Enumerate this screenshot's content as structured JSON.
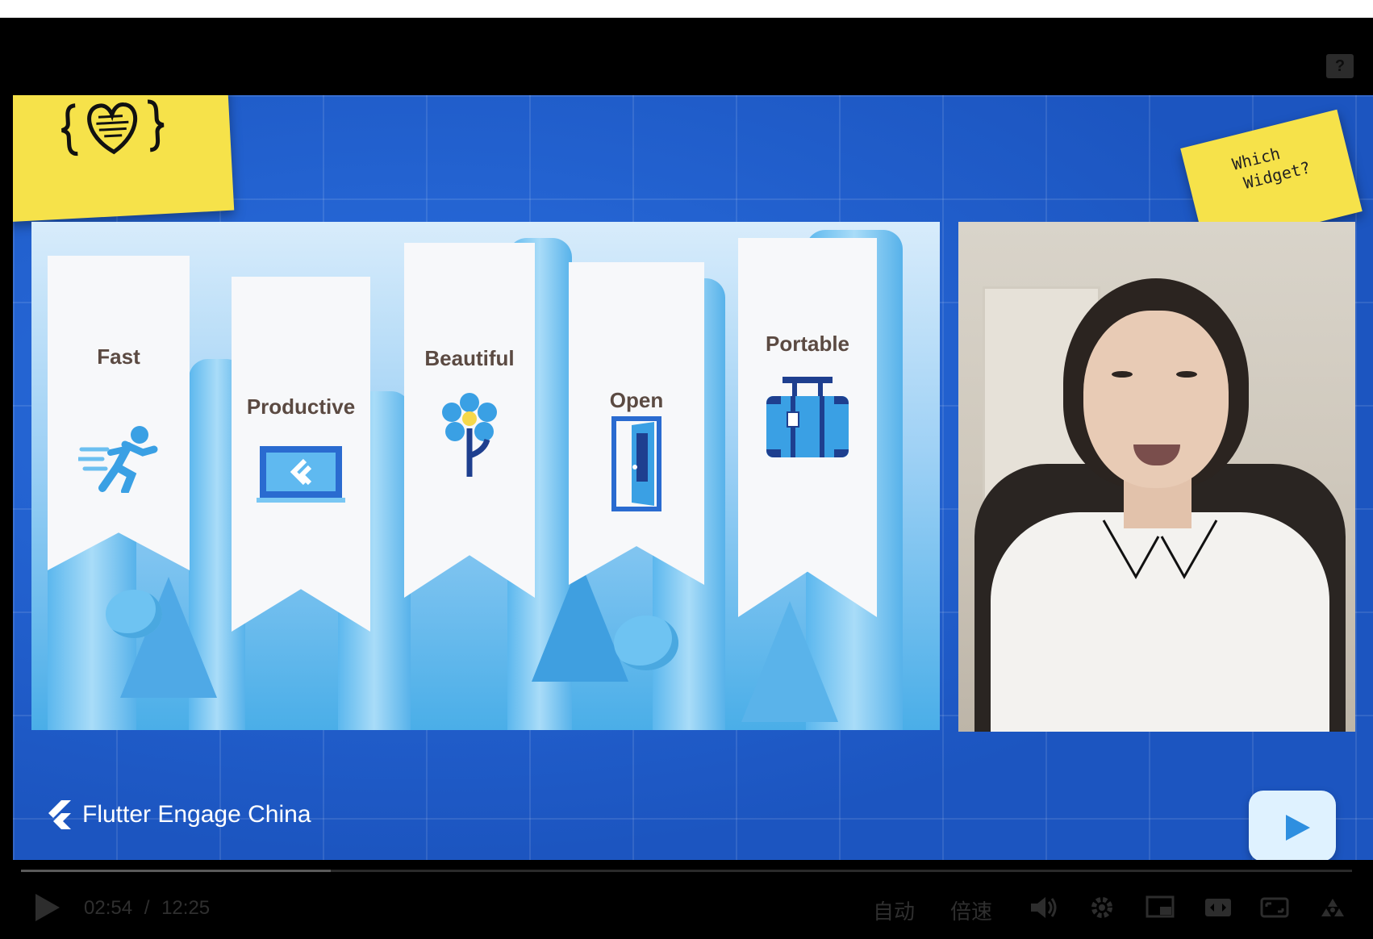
{
  "player": {
    "help_label": "?",
    "time_current": "02:54",
    "time_separator": "/",
    "time_total": "12:25",
    "progress": 0.233,
    "controls": {
      "auto_label": "自动",
      "speed_label": "倍速"
    }
  },
  "video": {
    "note_right_text": [
      "Which",
      "Widget?"
    ],
    "brand_text": "Flutter Engage China",
    "slide": {
      "banners": [
        {
          "label": "Fast",
          "icon": "runner-icon"
        },
        {
          "label": "Productive",
          "icon": "laptop-flutter-icon"
        },
        {
          "label": "Beautiful",
          "icon": "flower-icon"
        },
        {
          "label": "Open",
          "icon": "door-icon"
        },
        {
          "label": "Portable",
          "icon": "suitcase-icon"
        }
      ]
    }
  },
  "colors": {
    "video_bg": "#1f5fc9",
    "sticky": "#f6e24a",
    "banner_icon": "#3aa0e4",
    "banner_text": "#5b4a42",
    "controls": "#2f2f2f"
  }
}
